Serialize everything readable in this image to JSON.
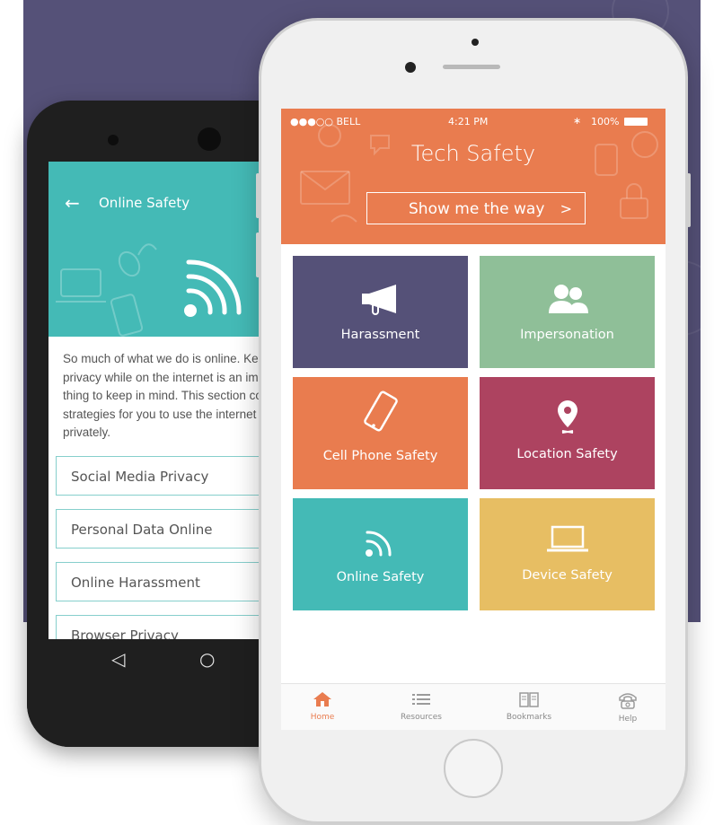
{
  "android": {
    "header_title": "Online Safety",
    "body_text": "So much of what we do is online. Keeping privacy while on the internet is an important thing to keep in mind. This section contains strategies for you to use the internet more privately.",
    "list_items": [
      {
        "label": "Social Media Privacy"
      },
      {
        "label": "Personal Data Online"
      },
      {
        "label": "Online Harassment"
      },
      {
        "label": "Browser Privacy"
      }
    ],
    "nav_back_icon": "back-triangle-icon",
    "nav_home_icon": "home-circle-icon"
  },
  "iphone": {
    "status": {
      "carrier": "●●●○○ BELL",
      "time": "4:21 PM",
      "battery": "100%"
    },
    "header": {
      "title": "Tech Safety",
      "cta_label": "Show me the way",
      "cta_chevron": ">"
    },
    "tiles": [
      {
        "label": "Harassment",
        "icon": "megaphone-icon",
        "color": "#555178"
      },
      {
        "label": "Impersonation",
        "icon": "people-icon",
        "color": "#8fbf98"
      },
      {
        "label": "Cell Phone Safety",
        "icon": "phone-icon",
        "color": "#e97c4f"
      },
      {
        "label": "Location Safety",
        "icon": "location-pin-icon",
        "color": "#ad4360"
      },
      {
        "label": "Online Safety",
        "icon": "wifi-icon",
        "color": "#44bab6"
      },
      {
        "label": "Device Safety",
        "icon": "laptop-icon",
        "color": "#e7be63"
      }
    ],
    "tabs": [
      {
        "label": "Home",
        "icon": "house-icon",
        "active": true
      },
      {
        "label": "Resources",
        "icon": "list-icon",
        "active": false
      },
      {
        "label": "Bookmarks",
        "icon": "book-icon",
        "active": false
      },
      {
        "label": "Help",
        "icon": "telephone-icon",
        "active": false
      }
    ]
  },
  "colors": {
    "background": "#555178",
    "accent_orange": "#e97c4f",
    "accent_teal": "#44bab6"
  }
}
